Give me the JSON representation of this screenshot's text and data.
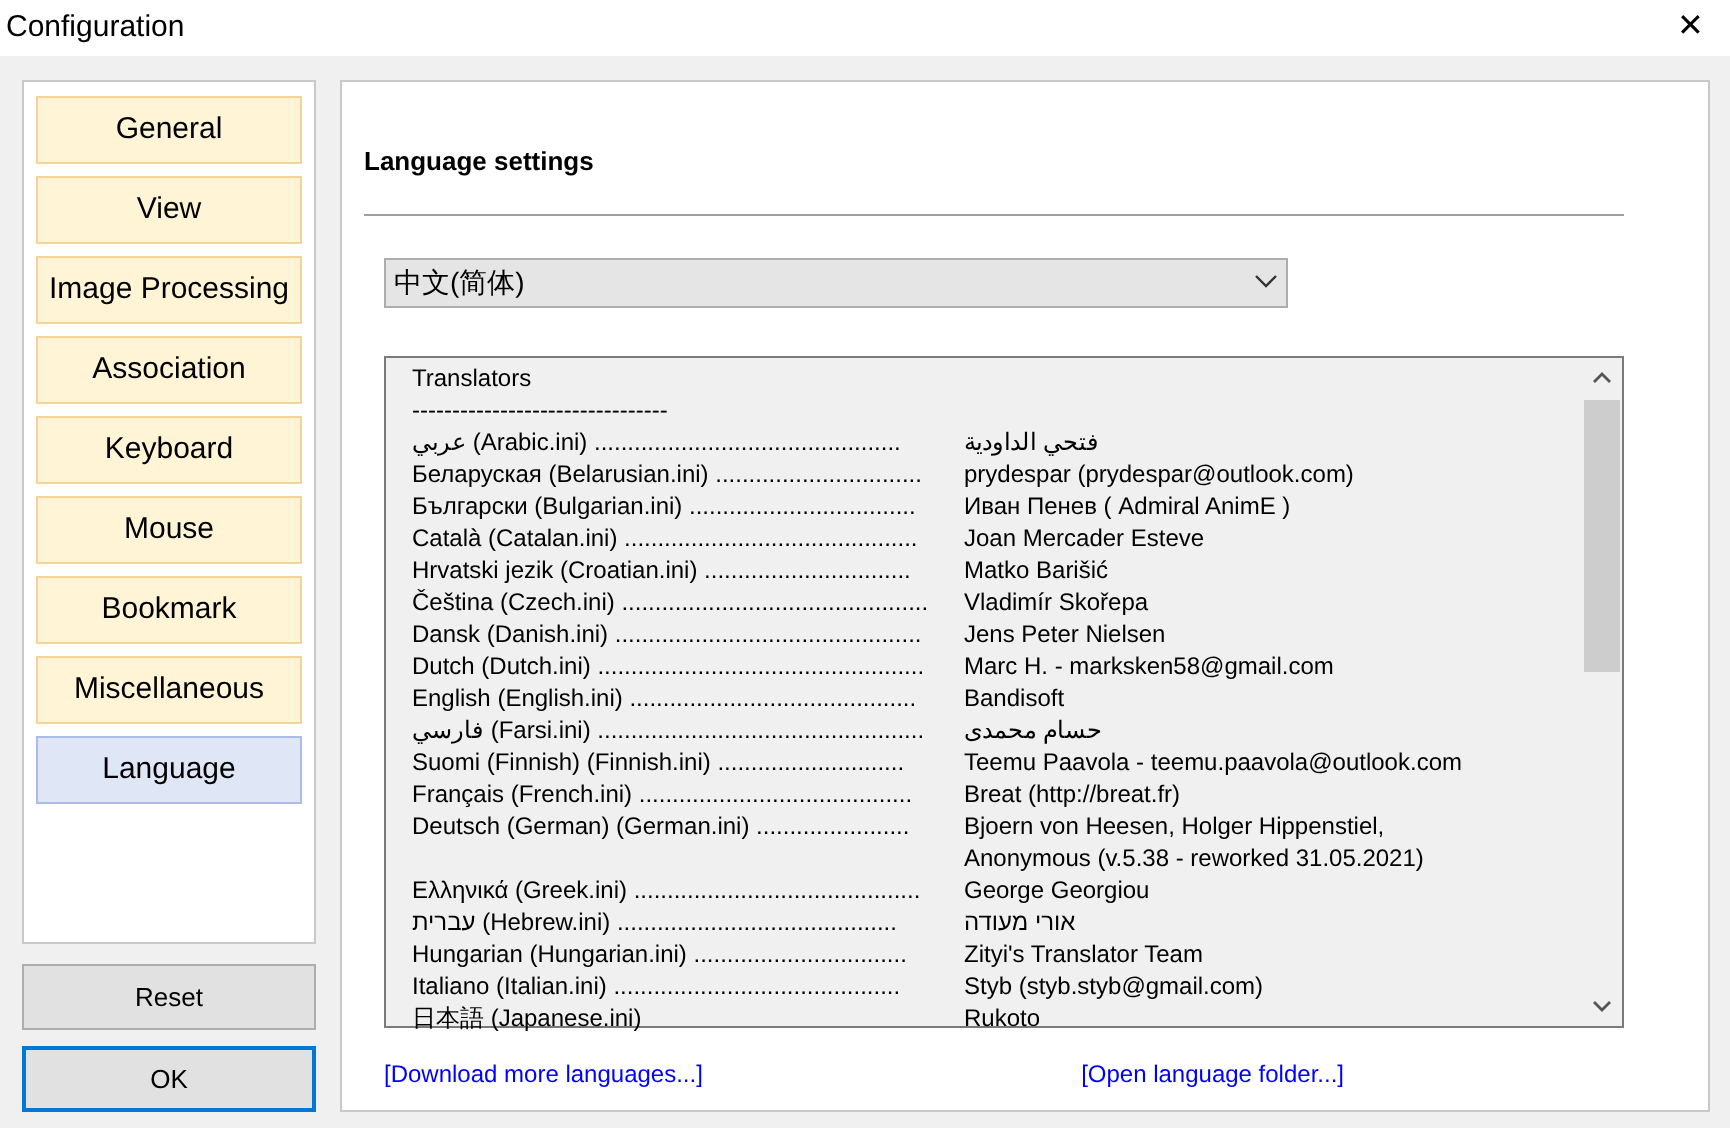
{
  "window": {
    "title": "Configuration",
    "close": "✕"
  },
  "sidebar": {
    "items": [
      {
        "label": "General",
        "selected": false
      },
      {
        "label": "View",
        "selected": false
      },
      {
        "label": "Image Processing",
        "selected": false
      },
      {
        "label": "Association",
        "selected": false
      },
      {
        "label": "Keyboard",
        "selected": false
      },
      {
        "label": "Mouse",
        "selected": false
      },
      {
        "label": "Bookmark",
        "selected": false
      },
      {
        "label": "Miscellaneous",
        "selected": false
      },
      {
        "label": "Language",
        "selected": true
      }
    ]
  },
  "buttons": [
    {
      "label": "Reset",
      "selected": false
    },
    {
      "label": "OK",
      "selected": true
    }
  ],
  "section_title": "Language settings",
  "language_select": {
    "value": "中文(简体)"
  },
  "translators": {
    "heading": "Translators",
    "separator": "--------------------------------",
    "rows": [
      {
        "language": "عربي (Arabic.ini) ..............................................",
        "translator": "فتحي الداودية"
      },
      {
        "language": "Беларуская (Belarusian.ini) ...............................",
        "translator": "prydespar (prydespar@outlook.com)"
      },
      {
        "language": "Български (Bulgarian.ini) ..................................",
        "translator": "Иван Пенев ( Admiral AnimE )"
      },
      {
        "language": "Català (Catalan.ini) ............................................",
        "translator": "Joan Mercader Esteve"
      },
      {
        "language": "Hrvatski jezik (Croatian.ini) ...............................",
        "translator": "Matko Barišić"
      },
      {
        "language": "Čeština (Czech.ini) ..............................................",
        "translator": "Vladimír Skořepa"
      },
      {
        "language": "Dansk (Danish.ini) ..............................................",
        "translator": "Jens Peter Nielsen"
      },
      {
        "language": "Dutch (Dutch.ini) .................................................",
        "translator": "Marc H. - marksken58@gmail.com"
      },
      {
        "language": "English (English.ini) ...........................................",
        "translator": "Bandisoft"
      },
      {
        "language": "فارسي (Farsi.ini) .................................................",
        "translator": "حسام محمدی"
      },
      {
        "language": "Suomi (Finnish) (Finnish.ini) ............................",
        "translator": "Teemu Paavola - teemu.paavola@outlook.com"
      },
      {
        "language": "Français (French.ini) .........................................",
        "translator": "Breat (http://breat.fr)"
      },
      {
        "language": "Deutsch (German) (German.ini) .......................",
        "translator": "Bjoern von Heesen, Holger Hippenstiel,",
        "continuation": "Anonymous (v.5.38 - reworked 31.05.2021)"
      },
      {
        "language": "Ελληνικά (Greek.ini) ...........................................",
        "translator": "George Georgiou"
      },
      {
        "language": "עברית (Hebrew.ini) ..........................................",
        "translator": "אורי מעודה"
      },
      {
        "language": "Hungarian (Hungarian.ini) ................................",
        "translator": "Zityi's Translator Team"
      },
      {
        "language": "Italiano (Italian.ini) ...........................................",
        "translator": "Styb (styb.styb@gmail.com)"
      },
      {
        "language": "日本語 (Japanese.ini)",
        "translator": "Rukoto"
      }
    ]
  },
  "links": [
    "[Download more languages...]",
    "[Open language folder...]"
  ]
}
